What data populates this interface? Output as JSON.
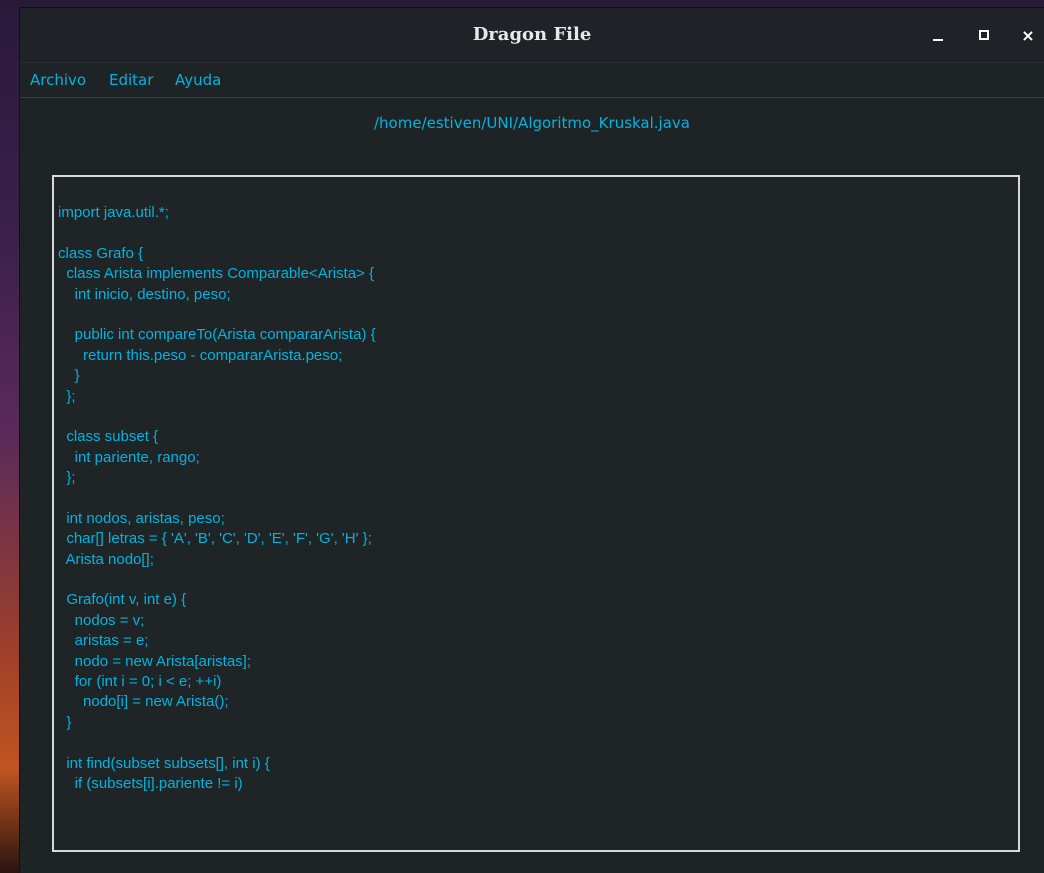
{
  "window": {
    "title": "Dragon File",
    "controls": {
      "minimize": "_",
      "maximize": "□",
      "close": "×"
    }
  },
  "menu": {
    "items": [
      {
        "label": "Archivo"
      },
      {
        "label": "Editar"
      },
      {
        "label": "Ayuda"
      }
    ]
  },
  "file": {
    "path": "/home/estiven/UNI/Algoritmo_Kruskal.java"
  },
  "editor": {
    "lines": [
      "import java.util.*;",
      "",
      "class Grafo {",
      "  class Arista implements Comparable<Arista> {",
      "    int inicio, destino, peso;",
      "",
      "    public int compareTo(Arista compararArista) {",
      "      return this.peso - compararArista.peso;",
      "    }",
      "  };",
      "",
      "  class subset {",
      "    int pariente, rango;",
      "  };",
      "",
      "  int nodos, aristas, peso;",
      "  char[] letras = { 'A', 'B', 'C', 'D', 'E', 'F', 'G', 'H' };",
      "  Arista nodo[];",
      "",
      "  Grafo(int v, int e) {",
      "    nodos = v;",
      "    aristas = e;",
      "    nodo = new Arista[aristas];",
      "    for (int i = 0; i < e; ++i)",
      "      nodo[i] = new Arista();",
      "  }",
      "",
      "  int find(subset subsets[], int i) {",
      "    if (subsets[i].pariente != i)"
    ]
  },
  "colors": {
    "accent": "#00b4e0",
    "window_bg": "#1e2426",
    "titlebar_bg": "#1f2328",
    "editor_border": "#d6dadc"
  }
}
